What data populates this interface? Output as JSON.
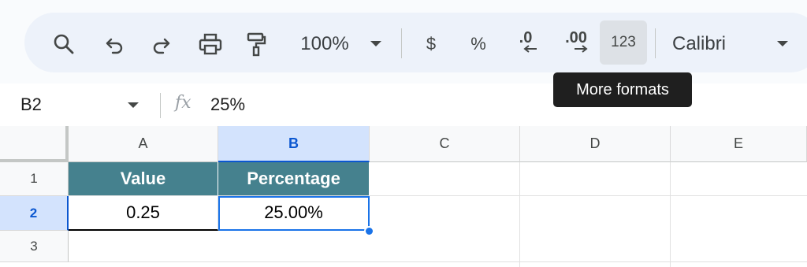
{
  "toolbar": {
    "zoom": "100%",
    "currency_symbol": "$",
    "percent_symbol": "%",
    "decrease_decimal": ".0",
    "increase_decimal": ".00",
    "more_formats": "123",
    "font": "Calibri"
  },
  "tooltip": {
    "text": "More formats"
  },
  "formula_bar": {
    "cell_ref": "B2",
    "fx": "fx",
    "content": "25%"
  },
  "grid": {
    "columns": [
      "A",
      "B",
      "C",
      "D",
      "E"
    ],
    "selected_column": "B",
    "rows": [
      "1",
      "2",
      "3"
    ],
    "selected_row": "2",
    "cells": {
      "A1": "Value",
      "B1": "Percentage",
      "A2": "0.25",
      "B2": "25.00%"
    }
  },
  "colors": {
    "header_fill": "#45818e",
    "selection": "#1a73e8",
    "toolbar_bg": "#edf2fa"
  }
}
